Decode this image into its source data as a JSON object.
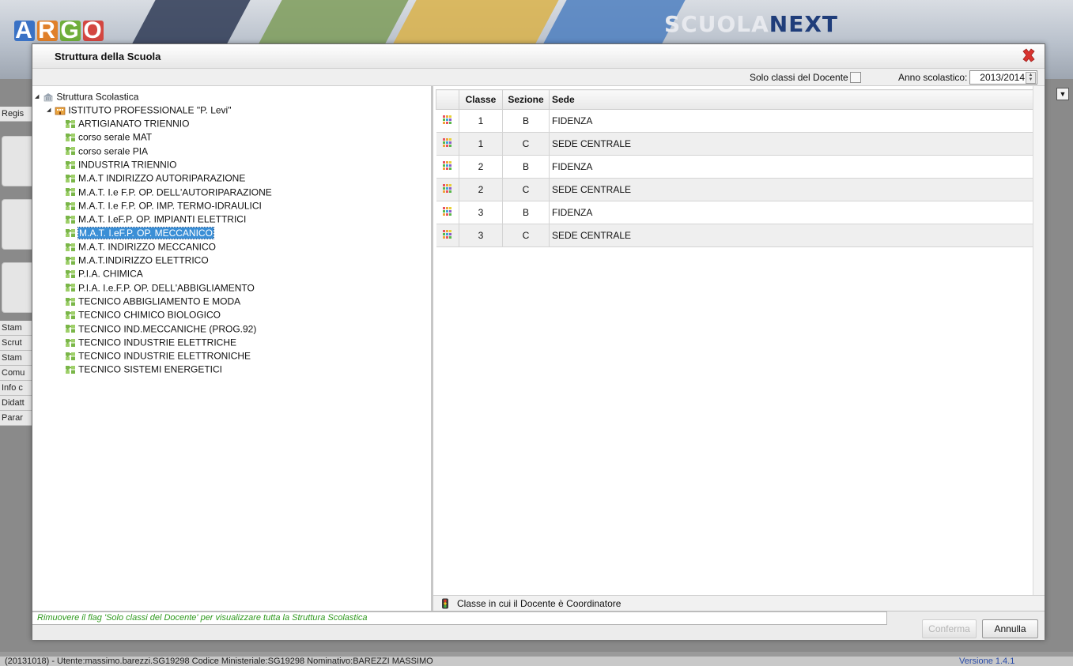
{
  "app": {
    "brand": "ARGO",
    "brand_letters": [
      "A",
      "R",
      "G",
      "O"
    ],
    "product_main": "SCUOLA",
    "product_accent": "NEXT",
    "left_menu": [
      "Regis",
      "Stam",
      "Scrut",
      "Stam",
      "Comu",
      "Info c",
      "Didatt",
      "Parar"
    ],
    "status_text": "(20131018) - Utente:massimo.barezzi.SG19298 Codice Ministeriale:SG19298 Nominativo:BAREZZI MASSIMO",
    "version": "Versione 1.4.1"
  },
  "dialog": {
    "title": "Struttura della Scuola",
    "solo_label": "Solo classi del Docente",
    "solo_checked": false,
    "anno_label": "Anno scolastico:",
    "anno_value": "2013/2014",
    "tree": {
      "root": "Struttura Scolastica",
      "institute": "ISTITUTO PROFESSIONALE \"P. Levi\"",
      "items": [
        "ARTIGIANATO TRIENNIO",
        "corso serale MAT",
        "corso serale PIA",
        "INDUSTRIA TRIENNIO",
        "M.A.T INDIRIZZO AUTORIPARAZIONE",
        "M.A.T. I.e F.P. OP. DELL'AUTORIPARAZIONE",
        "M.A.T. I.e F.P. OP. IMP. TERMO-IDRAULICI",
        "M.A.T. I.eF.P. OP. IMPIANTI ELETTRICI",
        "M.A.T. I.eF.P. OP. MECCANICO",
        "M.A.T. INDIRIZZO MECCANICO",
        "M.A.T.INDIRIZZO ELETTRICO",
        "P.I.A. CHIMICA",
        "P.I.A. I.e.F.P. OP. DELL'ABBIGLIAMENTO",
        "TECNICO ABBIGLIAMENTO E MODA",
        "TECNICO CHIMICO BIOLOGICO",
        "TECNICO IND.MECCANICHE (PROG.92)",
        "TECNICO INDUSTRIE ELETTRICHE",
        "TECNICO INDUSTRIE ELETTRONICHE",
        "TECNICO SISTEMI ENERGETICI"
      ],
      "selected_index": 8
    },
    "table": {
      "columns": [
        "Classe",
        "Sezione",
        "Sede"
      ],
      "rows": [
        [
          "1",
          "B",
          "FIDENZA"
        ],
        [
          "1",
          "C",
          "SEDE CENTRALE"
        ],
        [
          "2",
          "B",
          "FIDENZA"
        ],
        [
          "2",
          "C",
          "SEDE CENTRALE"
        ],
        [
          "3",
          "B",
          "FIDENZA"
        ],
        [
          "3",
          "C",
          "SEDE CENTRALE"
        ]
      ]
    },
    "legend": "Classe in cui il Docente è Coordinatore",
    "hint": "Rimuovere il flag 'Solo classi del Docente' per visualizzare tutta la Struttura Scolastica",
    "buttons": {
      "confirm": "Conferma",
      "cancel": "Annulla"
    },
    "colors": {
      "selection": "#3b8fd6",
      "hint_text": "#2f9a1e",
      "close_x": "#d9332f"
    },
    "icons": {
      "root": "school-building-icon",
      "institute": "institute-icon",
      "course": "course-puzzle-icon",
      "class_row": "class-grid-icon",
      "legend": "traffic-light-icon",
      "close": "close-icon"
    }
  }
}
